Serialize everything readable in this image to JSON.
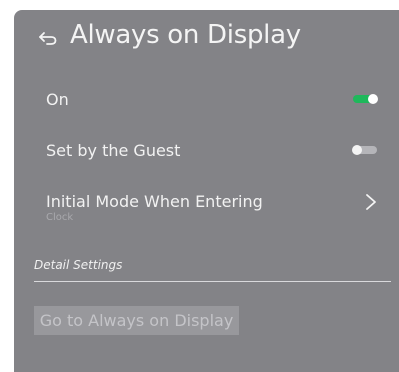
{
  "header": {
    "title": "Always on Display",
    "back_icon": "back-arrow-icon"
  },
  "settings": [
    {
      "label": "On",
      "control": "toggle",
      "value": true
    },
    {
      "label": "Set by the Guest",
      "control": "toggle",
      "value": false
    },
    {
      "label": "Initial Mode When Entering",
      "sublabel": "Clock",
      "control": "chevron-right-icon"
    }
  ],
  "detail": {
    "section_label": "Detail Settings",
    "button_label": "Go to Always on Display"
  },
  "colors": {
    "panel_bg": "#838387",
    "toggle_on": "#1fb85b",
    "toggle_off": "#b5b5b9",
    "button_bg": "#98989c"
  }
}
